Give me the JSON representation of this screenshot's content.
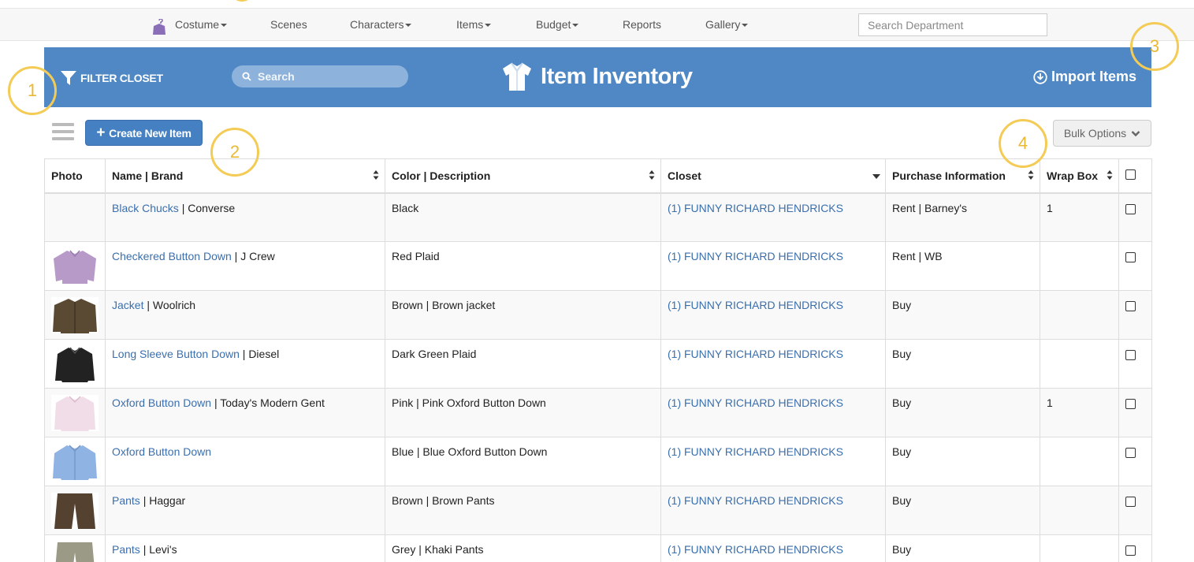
{
  "topnav": {
    "items": [
      {
        "label": "Costume",
        "dropdown": true
      },
      {
        "label": "Scenes",
        "dropdown": false
      },
      {
        "label": "Characters",
        "dropdown": true
      },
      {
        "label": "Items",
        "dropdown": true
      },
      {
        "label": "Budget",
        "dropdown": true
      },
      {
        "label": "Reports",
        "dropdown": false
      },
      {
        "label": "Gallery",
        "dropdown": true
      }
    ],
    "search_placeholder": "Search Department"
  },
  "banner": {
    "filter_label": "FILTER CLOSET",
    "search_label": "Search",
    "title": "Item Inventory",
    "import_label": "Import Items",
    "color": "#4f88c5"
  },
  "toolbar": {
    "create_label": "Create New Item",
    "bulk_label": "Bulk Options"
  },
  "table": {
    "headers": {
      "photo": "Photo",
      "name": "Name | Brand",
      "color": "Color | Description",
      "closet": "Closet",
      "purchase": "Purchase Information",
      "wrap": "Wrap Box"
    },
    "rows": [
      {
        "name": "Black Chucks",
        "brand": "Converse",
        "desc": "Black",
        "closet": "(1) FUNNY RICHARD HENDRICKS",
        "purchase": "Rent | Barney's",
        "wrap": "1",
        "photo": "none"
      },
      {
        "name": "Checkered Button Down",
        "brand": "J Crew",
        "desc": "Red Plaid",
        "closet": "(1) FUNNY RICHARD HENDRICKS",
        "purchase": "Rent | WB",
        "wrap": "",
        "photo": "lavender-shirt"
      },
      {
        "name": "Jacket",
        "brand": "Woolrich",
        "desc": "Brown | Brown jacket",
        "closet": "(1) FUNNY RICHARD HENDRICKS",
        "purchase": "Buy",
        "wrap": "",
        "photo": "brown-jacket"
      },
      {
        "name": "Long Sleeve Button Down",
        "brand": "Diesel",
        "desc": "Dark Green Plaid",
        "closet": "(1) FUNNY RICHARD HENDRICKS",
        "purchase": "Buy",
        "wrap": "",
        "photo": "black-shirt"
      },
      {
        "name": "Oxford Button Down",
        "brand": "Today's Modern Gent",
        "desc": "Pink | Pink Oxford Button Down",
        "closet": "(1) FUNNY RICHARD HENDRICKS",
        "purchase": "Buy",
        "wrap": "1",
        "photo": "pink-shirt"
      },
      {
        "name": "Oxford Button Down",
        "brand": "",
        "desc": "Blue | Blue Oxford Button Down",
        "closet": "(1) FUNNY RICHARD HENDRICKS",
        "purchase": "Buy",
        "wrap": "",
        "photo": "blue-shirt"
      },
      {
        "name": "Pants",
        "brand": "Haggar",
        "desc": "Brown | Brown Pants",
        "closet": "(1) FUNNY RICHARD HENDRICKS",
        "purchase": "Buy",
        "wrap": "",
        "photo": "brown-pants"
      },
      {
        "name": "Pants",
        "brand": "Levi's",
        "desc": "Grey | Khaki Pants",
        "closet": "(1) FUNNY RICHARD HENDRICKS",
        "purchase": "Buy",
        "wrap": "",
        "photo": "khaki-pants"
      }
    ]
  },
  "annotations": [
    "1",
    "2",
    "3",
    "4"
  ],
  "colors": {
    "link": "#3a6fae",
    "button": "#4480c2",
    "annotation": "#f3cb55"
  }
}
